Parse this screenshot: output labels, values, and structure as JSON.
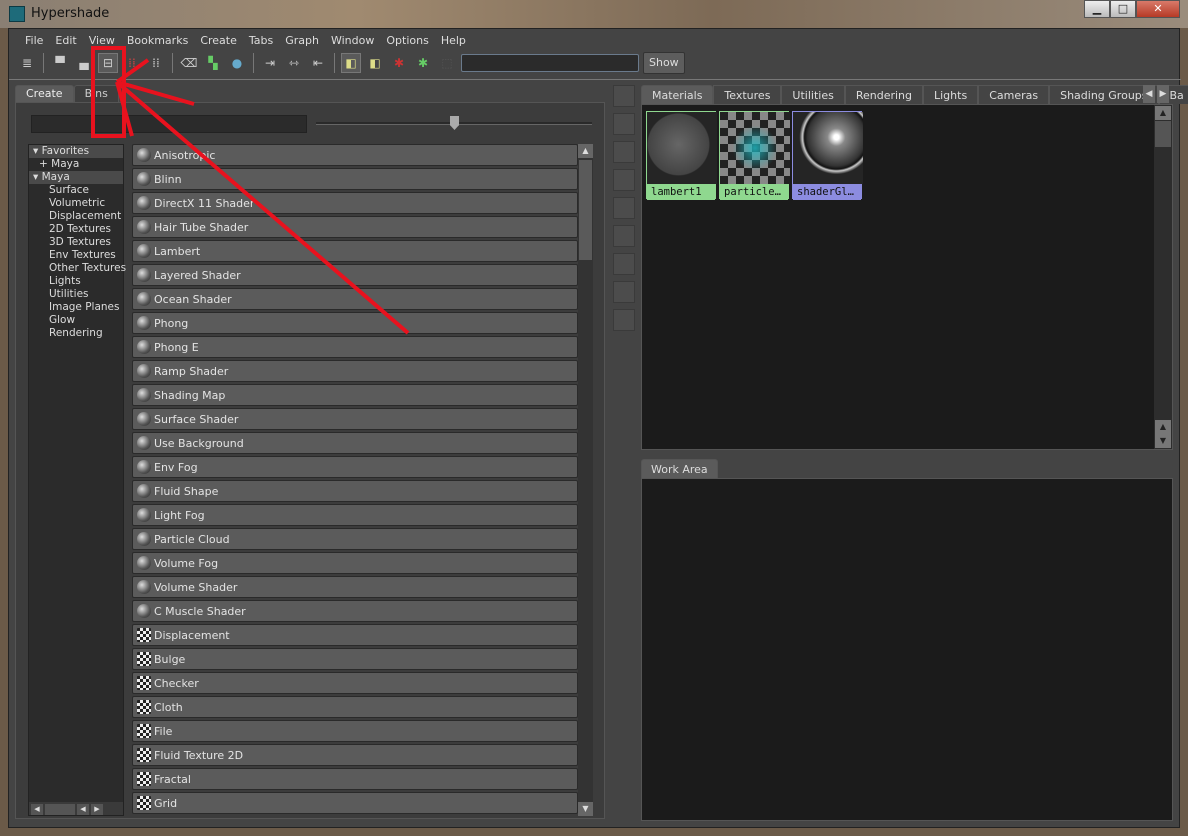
{
  "window": {
    "title": "Hypershade"
  },
  "menu": [
    "File",
    "Edit",
    "View",
    "Bookmarks",
    "Create",
    "Tabs",
    "Graph",
    "Window",
    "Options",
    "Help"
  ],
  "toolbar": {
    "show_label": "Show",
    "search_value": ""
  },
  "left": {
    "tabs": [
      "Create",
      "Bins"
    ],
    "tree": [
      {
        "label": "Favorites",
        "type": "hdr",
        "expanded": true
      },
      {
        "label": "+ Maya",
        "type": "ch"
      },
      {
        "label": "Maya",
        "type": "hdr",
        "expanded": true
      },
      {
        "label": "Surface",
        "type": "sub"
      },
      {
        "label": "Volumetric",
        "type": "sub"
      },
      {
        "label": "Displacement",
        "type": "sub"
      },
      {
        "label": "2D Textures",
        "type": "sub"
      },
      {
        "label": "3D Textures",
        "type": "sub"
      },
      {
        "label": "Env Textures",
        "type": "sub"
      },
      {
        "label": "Other Textures",
        "type": "sub"
      },
      {
        "label": "Lights",
        "type": "sub"
      },
      {
        "label": "Utilities",
        "type": "sub"
      },
      {
        "label": "Image Planes",
        "type": "sub"
      },
      {
        "label": "Glow",
        "type": "sub"
      },
      {
        "label": "Rendering",
        "type": "sub"
      }
    ],
    "nodes": [
      {
        "label": "Anisotropic",
        "icon": "sphere"
      },
      {
        "label": "Blinn",
        "icon": "sphere"
      },
      {
        "label": "DirectX 11 Shader",
        "icon": "sphere"
      },
      {
        "label": "Hair Tube Shader",
        "icon": "sphere"
      },
      {
        "label": "Lambert",
        "icon": "sphere"
      },
      {
        "label": "Layered Shader",
        "icon": "sphere"
      },
      {
        "label": "Ocean Shader",
        "icon": "sphere"
      },
      {
        "label": "Phong",
        "icon": "sphere"
      },
      {
        "label": "Phong E",
        "icon": "sphere"
      },
      {
        "label": "Ramp Shader",
        "icon": "sphere"
      },
      {
        "label": "Shading Map",
        "icon": "sphere"
      },
      {
        "label": "Surface Shader",
        "icon": "sphere"
      },
      {
        "label": "Use Background",
        "icon": "sphere"
      },
      {
        "label": "Env Fog",
        "icon": "sphere"
      },
      {
        "label": "Fluid Shape",
        "icon": "sphere"
      },
      {
        "label": "Light Fog",
        "icon": "sphere"
      },
      {
        "label": "Particle Cloud",
        "icon": "sphere"
      },
      {
        "label": "Volume Fog",
        "icon": "sphere"
      },
      {
        "label": "Volume Shader",
        "icon": "sphere"
      },
      {
        "label": "C Muscle Shader",
        "icon": "sphere"
      },
      {
        "label": "Displacement",
        "icon": "texture"
      },
      {
        "label": "Bulge",
        "icon": "texture"
      },
      {
        "label": "Checker",
        "icon": "texture"
      },
      {
        "label": "Cloth",
        "icon": "texture"
      },
      {
        "label": "File",
        "icon": "texture"
      },
      {
        "label": "Fluid Texture 2D",
        "icon": "texture"
      },
      {
        "label": "Fractal",
        "icon": "texture"
      },
      {
        "label": "Grid",
        "icon": "texture"
      }
    ]
  },
  "right": {
    "tabs": [
      "Materials",
      "Textures",
      "Utilities",
      "Rendering",
      "Lights",
      "Cameras",
      "Shading Groups",
      "Ba"
    ],
    "swatches": [
      {
        "label": "lambert1",
        "color": "#8fd88f"
      },
      {
        "label": "particle…",
        "color": "#8fd88f"
      },
      {
        "label": "shaderGl…",
        "color": "#8c8ce0"
      }
    ],
    "work_area_tab": "Work Area"
  },
  "annotation_color": "#e8121e"
}
